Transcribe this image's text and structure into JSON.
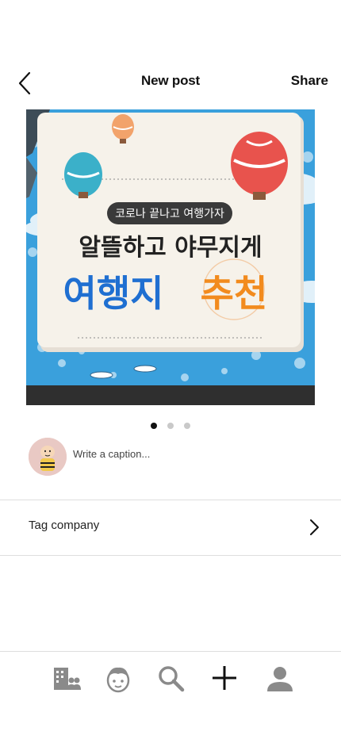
{
  "header": {
    "title": "New post",
    "share_label": "Share"
  },
  "post": {
    "image": {
      "pill_text": "코로나 끝나고 여행가자",
      "headline": "알뜰하고 야무지게",
      "title_blue": "여행지",
      "title_orange": "추천"
    },
    "carousel": {
      "count": 3,
      "active": 1
    }
  },
  "caption": {
    "placeholder": "Write a caption..."
  },
  "tag_row": {
    "label": "Tag company"
  },
  "bottom_nav": {
    "items": [
      "company-icon",
      "face-icon",
      "search-icon",
      "plus-icon",
      "profile-icon"
    ],
    "active_item": "plus-icon"
  },
  "colors": {
    "accent_blue": "#1f6fd1",
    "accent_orange": "#f28b1e",
    "sky_blue": "#3aa0dc"
  }
}
